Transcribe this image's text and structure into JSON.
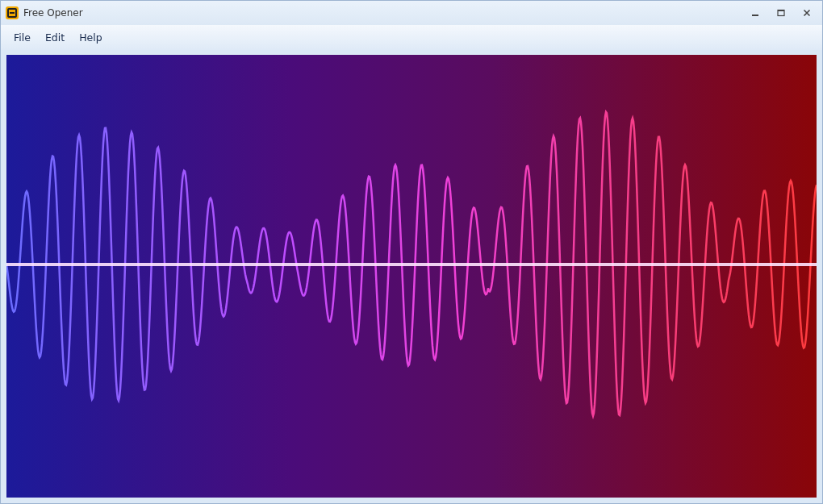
{
  "window": {
    "title": "Free Opener"
  },
  "menu": [
    {
      "label": "File"
    },
    {
      "label": "Edit"
    },
    {
      "label": "Help"
    }
  ]
}
